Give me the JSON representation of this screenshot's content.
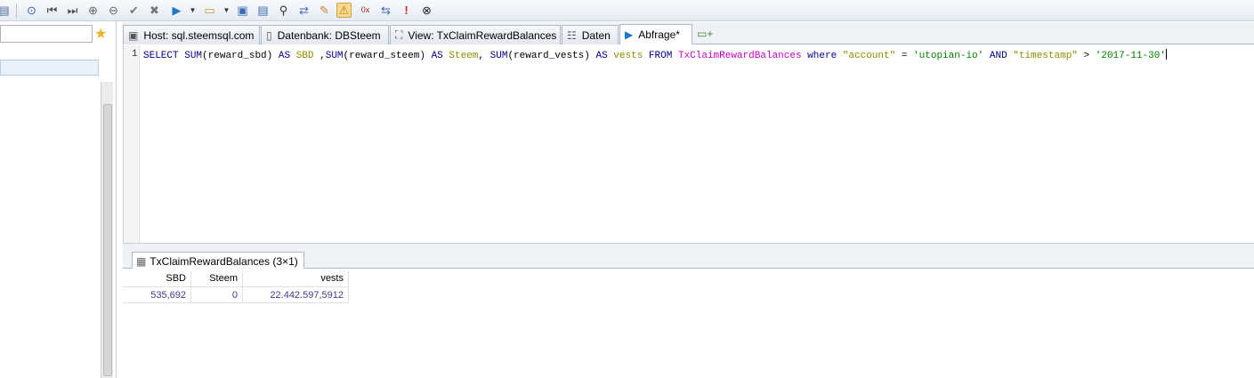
{
  "toolbar": {
    "icons": [
      "db-icon",
      "reconnect-icon",
      "first-record-icon",
      "last-record-icon",
      "add-record-icon",
      "remove-record-icon",
      "apply-icon",
      "cancel-icon",
      "run-icon",
      "run-dropdown-icon",
      "sql-help-icon",
      "sql-dropdown-icon",
      "save-icon",
      "load-icon",
      "binoculars-icon",
      "replace-icon",
      "edit-icon",
      "warning-icon",
      "hex-icon",
      "wrap-icon",
      "stop-icon",
      "close-circle-icon"
    ]
  },
  "tabs": [
    {
      "label": "Host: sql.steemsql.com",
      "icon": "host-icon"
    },
    {
      "label": "Datenbank: DBSteem",
      "icon": "database-icon"
    },
    {
      "label": "View: TxClaimRewardBalances",
      "icon": "view-icon"
    },
    {
      "label": "Daten",
      "icon": "table-icon"
    },
    {
      "label": "Abfrage*",
      "icon": "play-icon"
    }
  ],
  "editor": {
    "line_number": "1",
    "query": "SELECT SUM(reward_sbd) AS SBD ,SUM(reward_steem) AS Steem, SUM(reward_vests) AS vests FROM TxClaimRewardBalances where \"account\" = 'utopian-io' AND \"timestamp\" > '2017-11-30'"
  },
  "result": {
    "tab_label": "TxClaimRewardBalances (3×1)",
    "columns": [
      "SBD",
      "Steem",
      "vests"
    ],
    "rows": [
      [
        "535,692",
        "0",
        "22.442.597,5912"
      ]
    ]
  }
}
